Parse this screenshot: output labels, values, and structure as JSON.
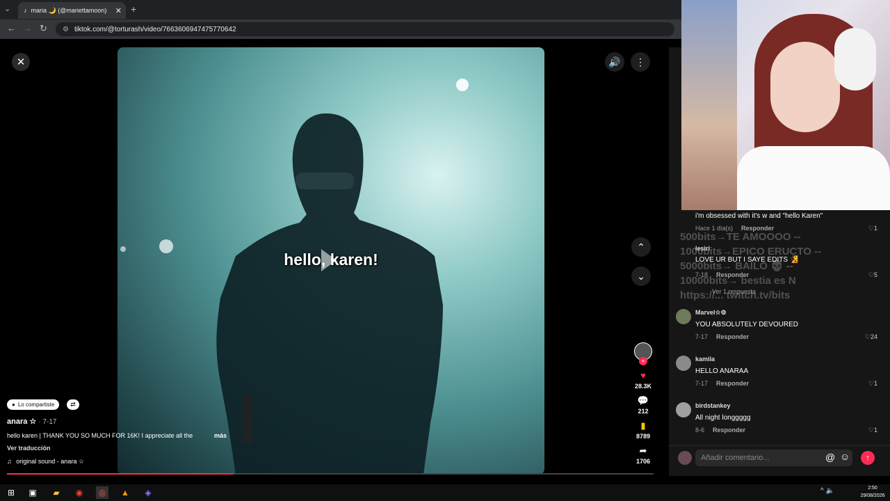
{
  "browser": {
    "tab_title": "maria 🌙 (@mariettamoon)",
    "url": "tiktok.com/@torturash/video/7663606947475770642"
  },
  "video": {
    "caption": "hello, karen!"
  },
  "rail": {
    "likes": "28.3K",
    "comments": "212",
    "saves": "8789",
    "shares": "1706"
  },
  "post": {
    "shared_label": "Lo compartiste",
    "author": "anara ☆",
    "date": "· 7-17",
    "description": "hello karen | THANK YOU SO MUCH FOR 16K! I appreciate all the",
    "more": "más",
    "translate": "Ver traducción",
    "sound": "original sound - anara ☆",
    "progress": 0.35
  },
  "comments_panel": {
    "reply_label": "Responder",
    "top_partial": {
      "text": "i'm obsessed with it's w  and  \"hello Karen\"",
      "meta": "Hace 1 día(s)",
      "likes": "1"
    },
    "first": {
      "user": "lesiri",
      "text": "LOVE UR BUT I SAYE EDITS 🧏",
      "meta": "7-18",
      "likes": "5",
      "replies": "Ver 1 respuesta"
    },
    "items": [
      {
        "user": "Marvel☆⚙",
        "text": "YOU ABSOLUTELY DEVOURED",
        "meta": "7-17",
        "likes": "24"
      },
      {
        "user": "kamila",
        "text": "HELLO ANARAA",
        "meta": "7-17",
        "likes": "1"
      },
      {
        "user": "birdstankey",
        "text": "All night longgggg",
        "meta": "8-6",
        "likes": "1"
      }
    ],
    "input_placeholder": "Añadir comentario..."
  },
  "stream_overlay": {
    "lines": [
      "500bits→TE AMOOOO --",
      "1000bits→EPICO ERUCTO --",
      "5000bits→ BAILO 💀 --",
      "10000bits→ bestia es N",
      "https://... twitch.tv/bits"
    ]
  },
  "taskbar": {
    "time": "2:50",
    "date": "29/08/2026"
  },
  "colors": {
    "accent": "#fe2c55",
    "panel": "#161616"
  }
}
